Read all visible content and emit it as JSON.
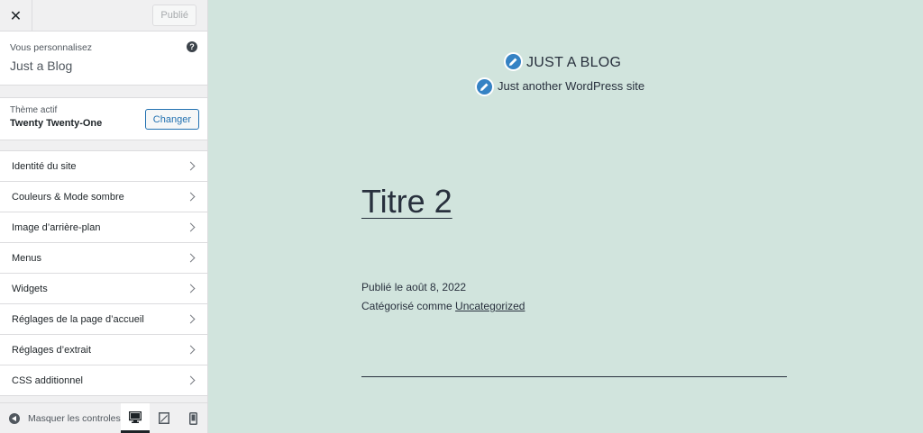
{
  "topbar": {
    "close_label": "✕",
    "publish_label": "Publié"
  },
  "info": {
    "label": "Vous personnalisez",
    "site_name": "Just a Blog",
    "help": "?"
  },
  "theme": {
    "label": "Thème actif",
    "name": "Twenty Twenty-One",
    "change_label": "Changer"
  },
  "menu": {
    "items": [
      {
        "label": "Identité du site"
      },
      {
        "label": "Couleurs & Mode sombre"
      },
      {
        "label": "Image d’arrière-plan"
      },
      {
        "label": "Menus"
      },
      {
        "label": "Widgets"
      },
      {
        "label": "Réglages de la page d’accueil"
      },
      {
        "label": "Réglages d’extrait"
      },
      {
        "label": "CSS additionnel"
      }
    ]
  },
  "footer": {
    "hide_label": "Masquer les controles",
    "devices": [
      "desktop-icon",
      "tablet-icon",
      "mobile-icon"
    ]
  },
  "preview": {
    "site_title": "JUST A BLOG",
    "site_description": "Just another WordPress site",
    "post_title": "Titre 2",
    "published": "Publié le août 8, 2022",
    "category_prefix": "Catégorisé comme ",
    "category": "Uncategorized"
  },
  "colors": {
    "background": "#d1e4dd",
    "accent": "#2271b1",
    "pencil": "#3582c4"
  }
}
